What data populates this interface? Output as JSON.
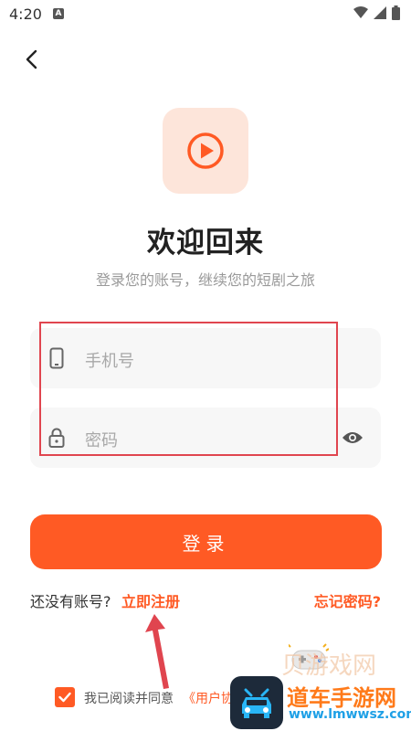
{
  "status_bar": {
    "time": "4:20",
    "notification_badge": "A"
  },
  "header": {
    "back_icon": "chevron-left-icon"
  },
  "logo": {
    "icon": "play-circle-icon",
    "tile_color": "#fde5da",
    "accent": "#ff5a24"
  },
  "welcome": {
    "title": "欢迎回来",
    "subtitle": "登录您的账号，继续您的短剧之旅"
  },
  "form": {
    "phone": {
      "placeholder": "手机号",
      "icon": "phone-icon"
    },
    "password": {
      "placeholder": "密码",
      "icon": "lock-icon",
      "toggle_icon": "eye-icon"
    },
    "login_label": "登录"
  },
  "links": {
    "no_account": "还没有账号?",
    "register": "立即注册",
    "forgot": "忘记密码?"
  },
  "agreement": {
    "checked": true,
    "text": "我已阅读并同意",
    "link": "《用户协"
  },
  "watermark": {
    "faded": "贝游戏网",
    "text": "道车手游网",
    "url": "www.lmwwsz.com"
  },
  "colors": {
    "accent": "#ff5a24",
    "highlight": "#e0454f",
    "input_bg": "#f7f7f7"
  }
}
